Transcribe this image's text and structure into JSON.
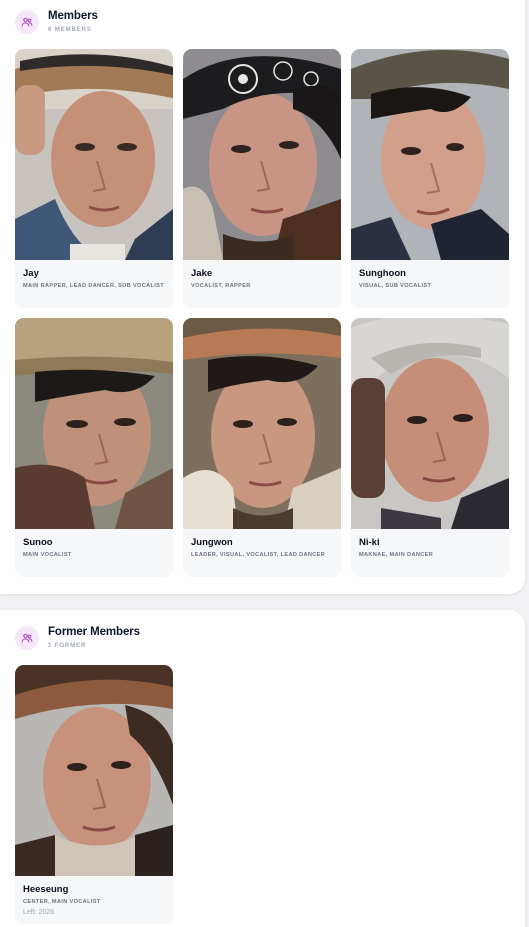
{
  "members_section": {
    "title": "Members",
    "subtitle": "6 MEMBERS",
    "icon": "users-icon",
    "icon_color": "#b04ac9",
    "members": [
      {
        "name": "Jay",
        "roles": "MAIN RAPPER, LEAD DANCER, SUB VOCALIST"
      },
      {
        "name": "Jake",
        "roles": "VOCALIST, RAPPER"
      },
      {
        "name": "Sunghoon",
        "roles": "VISUAL, SUB VOCALIST"
      },
      {
        "name": "Sunoo",
        "roles": "MAIN VOCALIST"
      },
      {
        "name": "Jungwon",
        "roles": "LEADER, VISUAL, VOCALIST, LEAD DANCER"
      },
      {
        "name": "Ni-ki",
        "roles": "MAKNAE, MAIN DANCER"
      }
    ]
  },
  "former_section": {
    "title": "Former Members",
    "subtitle": "1 FORMER",
    "icon": "users-icon",
    "members": [
      {
        "name": "Heeseung",
        "roles": "CENTER, MAIN VOCALIST",
        "left": "Left: 2026"
      }
    ]
  }
}
